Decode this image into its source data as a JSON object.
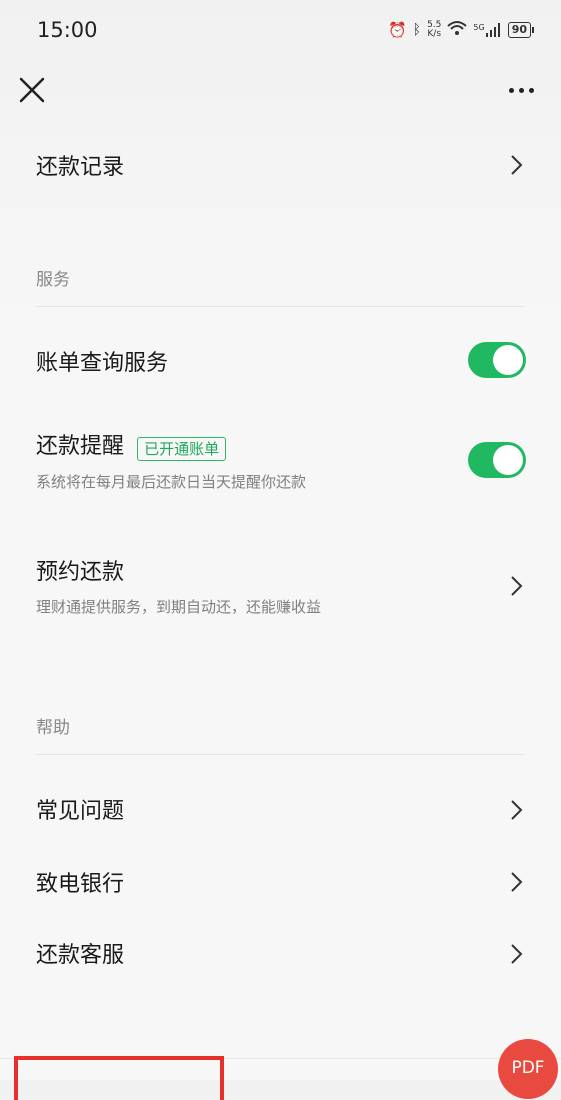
{
  "status_bar": {
    "time": "15:00",
    "speed_value": "5.5",
    "speed_unit": "K/s",
    "network": "5G",
    "battery": "90"
  },
  "nav": {
    "close_icon": "close-icon",
    "more_icon": "more-icon"
  },
  "repayment_record": {
    "label": "还款记录"
  },
  "services": {
    "section_label": "服务",
    "bill_query": {
      "label": "账单查询服务",
      "enabled": true
    },
    "repayment_reminder": {
      "label": "还款提醒",
      "tag": "已开通账单",
      "description": "系统将在每月最后还款日当天提醒你还款",
      "enabled": true
    },
    "scheduled_repayment": {
      "label": "预约还款",
      "description": "理财通提供服务，到期自动还，还能赚收益"
    }
  },
  "help": {
    "section_label": "帮助",
    "items": [
      {
        "label": "常见问题"
      },
      {
        "label": "致电银行"
      },
      {
        "label": "还款客服"
      }
    ]
  },
  "overlay": {
    "pdf_badge": "PDF",
    "accent_color": "#20b962",
    "highlight_color": "#e8302a"
  }
}
